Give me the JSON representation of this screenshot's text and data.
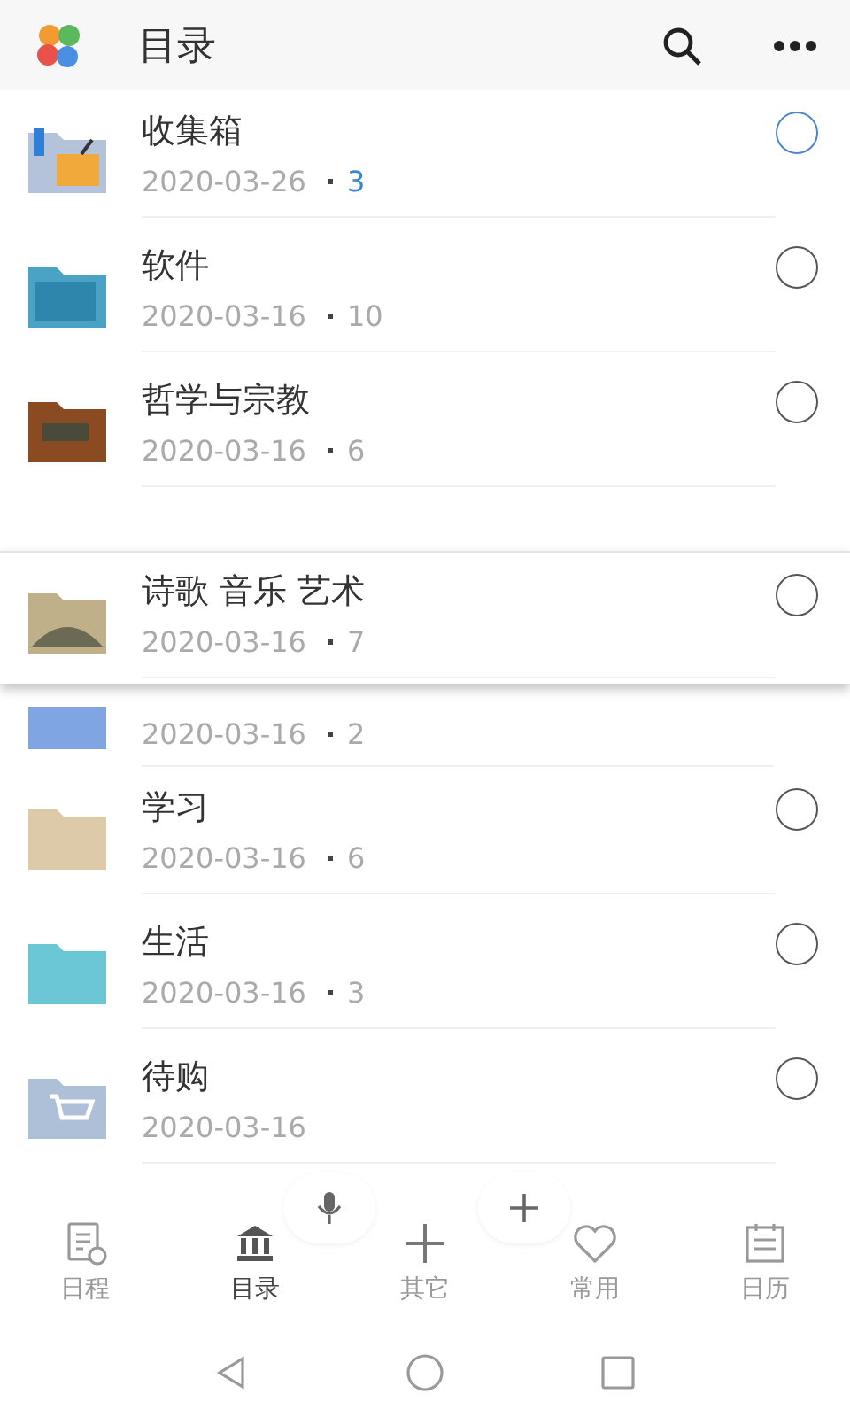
{
  "header": {
    "title": "目录"
  },
  "folders": [
    {
      "name": "收集箱",
      "date": "2020-03-26",
      "count": "3",
      "active": true,
      "dragging": false
    },
    {
      "name": "软件",
      "date": "2020-03-16",
      "count": "10",
      "active": false,
      "dragging": false
    },
    {
      "name": "哲学与宗教",
      "date": "2020-03-16",
      "count": "6",
      "active": false,
      "dragging": false
    },
    {
      "name": "诗歌 音乐 艺术",
      "date": "2020-03-16",
      "count": "7",
      "active": false,
      "dragging": true
    },
    {
      "date": "2020-03-16",
      "count": "2",
      "dragging": false
    },
    {
      "name": "学习",
      "date": "2020-03-16",
      "count": "6",
      "active": false,
      "dragging": false
    },
    {
      "name": "生活",
      "date": "2020-03-16",
      "count": "3",
      "active": false,
      "dragging": false
    },
    {
      "name": "待购",
      "date": "2020-03-16",
      "active": false,
      "dragging": false
    }
  ],
  "tabs": [
    {
      "label": "日程",
      "selected": false
    },
    {
      "label": "目录",
      "selected": true
    },
    {
      "label": "其它",
      "selected": false
    },
    {
      "label": "常用",
      "selected": false
    },
    {
      "label": "日历",
      "selected": false
    }
  ]
}
